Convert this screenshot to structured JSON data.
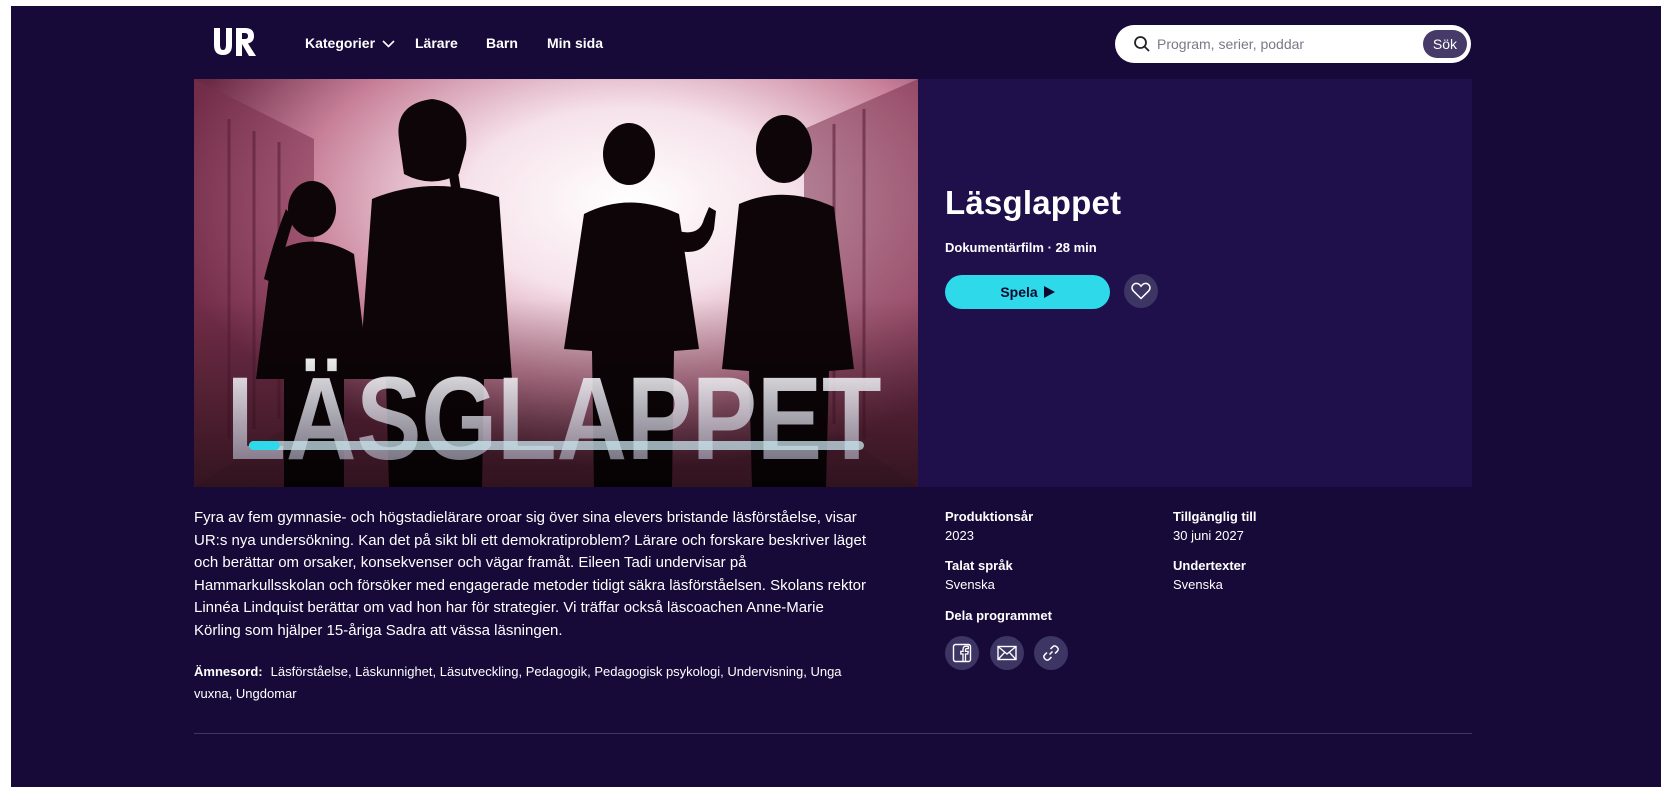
{
  "header": {
    "logo_text": "UR",
    "nav": {
      "kategorier": "Kategorier",
      "larare": "Lärare",
      "barn": "Barn",
      "min_sida": "Min sida"
    },
    "search": {
      "placeholder": "Program, serier, poddar",
      "button": "Sök"
    }
  },
  "program": {
    "title": "Läsglappet",
    "meta": "Dokumentärfilm · 28 min",
    "play_label": "Spela",
    "image_title_text": "LÄSGLAPPET",
    "watch_progress": 0.05,
    "description": "Fyra av fem gymnasie- och högstadielärare oroar sig över sina elevers bristande läsförståelse, visar UR:s nya undersökning. Kan det på sikt bli ett demokratiproblem? Lärare och forskare beskriver läget och berättar om orsaker, konsekvenser och vägar framåt. Eileen Tadi undervisar på Hammarkullsskolan och försöker med engagerade metoder tidigt säkra läsförståelsen. Skolans rektor Linnéa Lindquist berättar om vad hon har för strategier. Vi träffar också läscoachen Anne-Marie Körling som hjälper 15-åriga Sadra att vässa läsningen.",
    "keywords_label": "Ämnesord:",
    "keywords": "Läsförståelse, Läskunnighet, Läsutveckling, Pedagogik, Pedagogisk psykologi, Undervisning, Unga vuxna, Ungdomar"
  },
  "info": {
    "produktionsar": {
      "label": "Produktionsår",
      "value": "2023"
    },
    "tillganglig": {
      "label": "Tillgänglig till",
      "value": "30 juni 2027"
    },
    "talat_sprak": {
      "label": "Talat språk",
      "value": "Svenska"
    },
    "undertexter": {
      "label": "Undertexter",
      "value": "Svenska"
    },
    "dela": {
      "label": "Dela programmet"
    }
  },
  "colors": {
    "background": "#170a38",
    "hero_panel": "#1f0f4b",
    "accent": "#2ed9ea",
    "button_dark": "#3d3564"
  },
  "icons": [
    "ur-logo",
    "chevron-down-icon",
    "search-icon",
    "play-icon",
    "heart-icon",
    "facebook-icon",
    "mail-icon",
    "link-icon"
  ]
}
